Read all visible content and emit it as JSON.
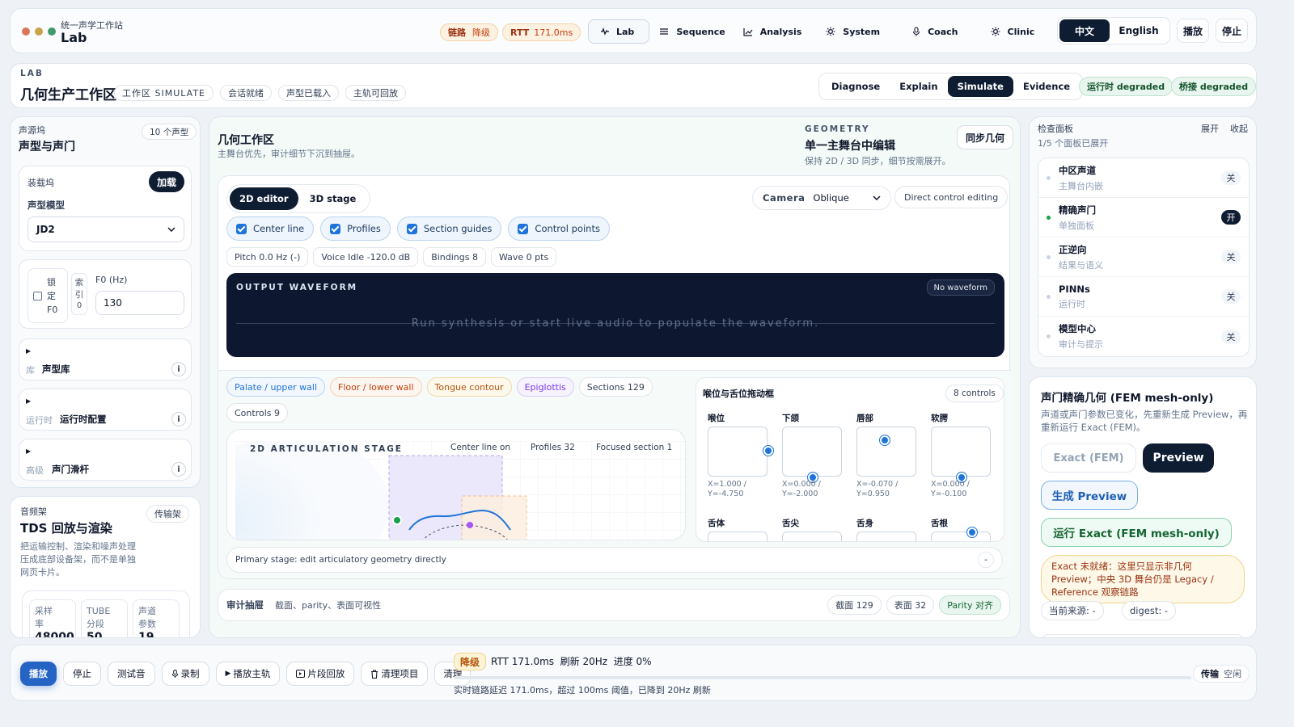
{
  "topbar": {
    "subtitle": "统一声学工作站",
    "title": "Lab",
    "status_link": "链路",
    "status_link_state": "降级",
    "rtt": "RTT",
    "rtt_value": "171.0ms",
    "nav": [
      {
        "label": "Lab",
        "icon": "waveform-icon"
      },
      {
        "label": "Sequence",
        "icon": "list-icon"
      },
      {
        "label": "Analysis",
        "icon": "chart-icon"
      },
      {
        "label": "System",
        "icon": "gear-icon"
      },
      {
        "label": "Coach",
        "icon": "mic-icon"
      },
      {
        "label": "Clinic",
        "icon": "gear-icon"
      }
    ],
    "lang_zh": "中文",
    "lang_en": "English",
    "play": "播放",
    "stop": "停止"
  },
  "lab_header": {
    "eyebrow": "LAB",
    "title": "几何生产工作区",
    "chips": [
      "工作区 SIMULATE",
      "会话就绪",
      "声型已载入",
      "主轨可回放"
    ],
    "modes": [
      "Diagnose",
      "Explain",
      "Simulate",
      "Evidence"
    ],
    "active_mode": "Simulate",
    "runtime_badge": "运行时 degraded",
    "bridge_badge": "桥接 degraded"
  },
  "left_panel": {
    "eyebrow": "声源坞",
    "title": "声型与声门",
    "count": "10 个声型",
    "dock_label": "装载坞",
    "load_button": "加载",
    "model_label": "声型模型",
    "model_value": "JD2",
    "lock_f0": "锁定F0",
    "index_label": "索引",
    "index_value": "0",
    "f0_label": "F0 (Hz)",
    "f0_value": "130",
    "sections": [
      {
        "tag": "库",
        "label": "声型库"
      },
      {
        "tag": "运行时",
        "label": "运行时配置"
      },
      {
        "tag": "高级",
        "label": "声门滑杆"
      }
    ],
    "audio_eyebrow": "音频架",
    "audio_title": "TDS 回放与渲染",
    "audio_transport": "传输架",
    "audio_desc": "把运输控制、渲染和噪声处理压成底部设备架，而不是单独网页卡片。",
    "stats": [
      {
        "label": "采样率",
        "value": "48000"
      },
      {
        "label": "TUBE 分段",
        "value": "50"
      },
      {
        "label": "声道参数",
        "value": "19"
      }
    ]
  },
  "geometry": {
    "title": "几何工作区",
    "subtitle": "主舞台优先，审计细节下沉到抽屉。",
    "eyebrow": "GEOMETRY",
    "headline": "单一主舞台中编辑",
    "desc": "保持 2D / 3D 同步，细节按需展开。",
    "sync_button": "同步几何",
    "tabs": [
      "2D editor",
      "3D stage"
    ],
    "camera_label": "Camera",
    "camera_value": "Oblique",
    "direct_control": "Direct control editing",
    "toggles": [
      "Center line",
      "Profiles",
      "Section guides",
      "Control points"
    ],
    "metrics": [
      "Pitch 0.0 Hz (-)",
      "Voice Idle -120.0 dB",
      "Bindings 8",
      "Wave 0 pts"
    ],
    "waveform_title": "OUTPUT WAVEFORM",
    "waveform_badge": "No waveform",
    "waveform_message": "Run synthesis or start live audio to populate the waveform.",
    "legend": [
      {
        "label": "Palate / upper wall",
        "color": "#1e74d8"
      },
      {
        "label": "Floor / lower wall",
        "color": "#c2410c"
      },
      {
        "label": "Tongue contour",
        "color": "#b45309"
      },
      {
        "label": "Epiglottis",
        "color": "#7c3aed"
      }
    ],
    "sections_count": "Sections 129",
    "controls_count": "Controls 9",
    "stage_title": "2D ARTICULATION STAGE",
    "stage_stats": [
      "Center line on",
      "Profiles 32",
      "Focused section 1"
    ],
    "primary_note": "Primary stage: edit articulatory geometry directly",
    "primary_button": "-",
    "audit_label": "审计抽屉",
    "audit_desc": "截面、parity、表面可视性",
    "audit_chips": [
      "截面 129",
      "表面 32",
      "Parity 对齐"
    ]
  },
  "control_box": {
    "title": "喉位与舌位拖动框",
    "count": "8 controls",
    "pads": [
      {
        "label": "喉位",
        "readout": "X=1.000 / Y=-4.750",
        "x": 1.0,
        "y": -4.75
      },
      {
        "label": "下颌",
        "readout": "X=0.000 / Y=-2.000",
        "x": 0.0,
        "y": -2.0
      },
      {
        "label": "唇部",
        "readout": "X=-0.070 / Y=0.950",
        "x": -0.07,
        "y": 0.95
      },
      {
        "label": "软腭",
        "readout": "X=0.000 / Y=-0.100",
        "x": 0.0,
        "y": -0.1
      }
    ],
    "lower_pads": [
      "舌体",
      "舌尖",
      "舌身",
      "舌根"
    ]
  },
  "inspector": {
    "title": "检查面板",
    "expand": "展开",
    "collapse": "收起",
    "summary": "1/5 个面板已展开",
    "items": [
      {
        "label": "中区声道",
        "sub": "主舞台内嵌",
        "state": "关",
        "on": false
      },
      {
        "label": "精确声门",
        "sub": "单独面板",
        "state": "开",
        "on": true
      },
      {
        "label": "正逆向",
        "sub": "结果与语义",
        "state": "关",
        "on": false
      },
      {
        "label": "PINNs",
        "sub": "运行时",
        "state": "关",
        "on": false
      },
      {
        "label": "模型中心",
        "sub": "审计与提示",
        "state": "关",
        "on": false
      }
    ]
  },
  "glottis": {
    "title": "声门精确几何 (FEM mesh-only)",
    "desc": "声道或声门参数已变化，先重新生成 Preview，再重新运行 Exact (FEM)。",
    "exact_button": "Exact (FEM)",
    "preview_button": "Preview",
    "generate_button": "生成 Preview",
    "run_button": "运行 Exact (FEM mesh-only)",
    "warning": "Exact 未就绪：这里只显示非几何 Preview；中央 3D 舞台仍是 Legacy / Reference 观察链路",
    "source": "当前来源: -",
    "digest": "digest: -"
  },
  "bottombar": {
    "buttons": [
      "播放",
      "停止",
      "测试音",
      "录制",
      "播放主轨",
      "片段回放",
      "清理项目",
      "清理"
    ],
    "degraded": "降级",
    "status": "RTT 171.0ms  刷新 20Hz  进度 0%",
    "progress": 0,
    "message": "实时链路延迟 171.0ms，超过 100ms 阈值，已降到 20Hz 刷新",
    "transport_label": "传输",
    "transport_state": "空闲"
  }
}
